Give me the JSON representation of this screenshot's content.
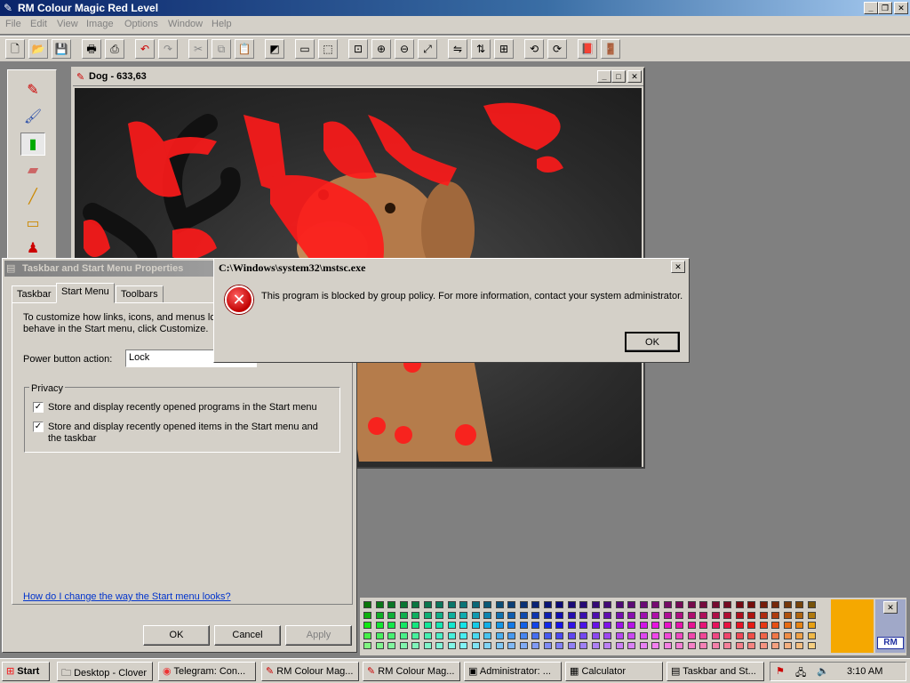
{
  "app": {
    "title": "RM Colour Magic  Red Level",
    "menu": [
      "File",
      "Edit",
      "View",
      "Image",
      "Options",
      "Window",
      "Help"
    ],
    "title_buttons": [
      "_",
      "❐",
      "✕"
    ]
  },
  "toolbar": {
    "icons": [
      "new-icon",
      "open-icon",
      "save-icon",
      "print-icon",
      "print-preview-icon",
      "undo-icon",
      "redo-icon",
      "cut-icon",
      "copy-icon",
      "paste-icon",
      "select-icon",
      "frame-icon",
      "select-all-icon",
      "zoom-actual-icon",
      "zoom-in-icon",
      "zoom-out-icon",
      "fit-icon",
      "flip-horizontal-icon",
      "flip-vertical-icon",
      "grid-icon",
      "rotate-left-icon",
      "rotate-right-icon",
      "book-icon",
      "exit-icon"
    ]
  },
  "tools": [
    "pen-icon",
    "brush-icon",
    "spray-icon",
    "eraser-icon",
    "line-icon",
    "rectangle-icon",
    "stamp-icon"
  ],
  "dog_window": {
    "title": "Dog - 633,63"
  },
  "props_dialog": {
    "title": "Taskbar and Start Menu Properties",
    "tabs": [
      "Taskbar",
      "Start Menu",
      "Toolbars"
    ],
    "intro": "To customize how links, icons, and menus look and behave in the Start menu, click Customize.",
    "intro_line1": "To customize how links, icons, and menus loo",
    "intro_line2": "behave in the Start menu, click Customize.",
    "power_label": "Power button action:",
    "power_value": "Lock",
    "privacy_group": "Privacy",
    "chk1": "Store and display recently opened programs in the Start menu",
    "chk2_line1": "Store and display recently opened items in the Start menu and",
    "chk2_line2": "the taskbar",
    "help_link": "How do I change the way the Start menu looks?",
    "ok": "OK",
    "cancel": "Cancel",
    "apply": "Apply"
  },
  "error_dialog": {
    "title": "C:\\Windows\\system32\\mstsc.exe",
    "message": "This program is blocked by group policy. For more information, contact your system administrator.",
    "ok": "OK"
  },
  "palette": {
    "logo": "RM"
  },
  "taskbar": {
    "start": "Start",
    "tasks": [
      "Desktop - Clover",
      "Telegram: Con...",
      "RM Colour Mag...",
      "RM Colour Mag...",
      "Administrator: ...",
      "Calculator",
      "Taskbar and St..."
    ],
    "clock": "3:10 AM"
  }
}
